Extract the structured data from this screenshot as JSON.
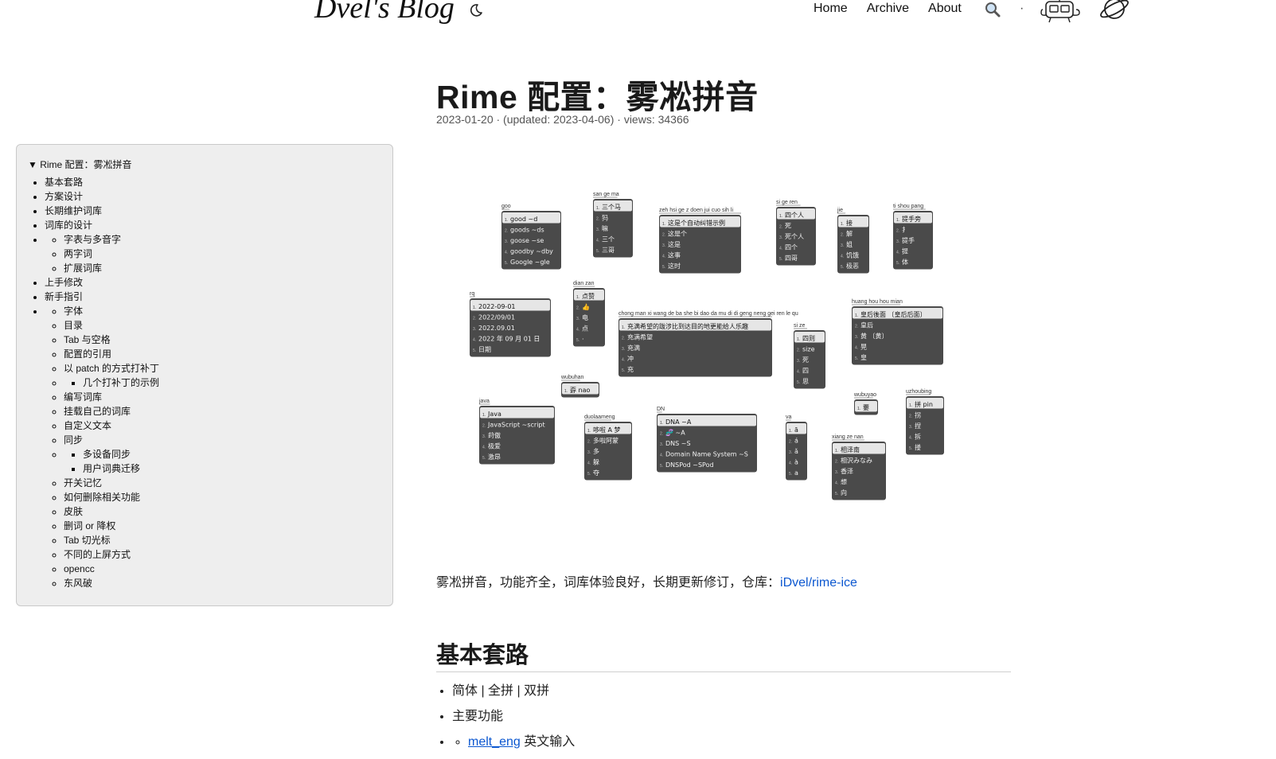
{
  "header": {
    "site_title": "Dvel's Blog",
    "nav": {
      "home": "Home",
      "archive": "Archive",
      "about": "About",
      "separator": "·"
    },
    "icons": [
      "moon-icon",
      "search-icon",
      "robot-icon",
      "planet-icon"
    ]
  },
  "toc": {
    "summary": "▼ Rime 配置：雾凇拼音",
    "items": [
      {
        "label": "基本套路"
      },
      {
        "label": "方案设计"
      },
      {
        "label": "长期维护词库"
      },
      {
        "label": "词库的设计",
        "children": [
          {
            "label": "字表与多音字"
          },
          {
            "label": "两字词"
          },
          {
            "label": "扩展词库"
          }
        ]
      },
      {
        "label": "上手修改"
      },
      {
        "label": "新手指引",
        "children": [
          {
            "label": "字体"
          },
          {
            "label": "目录"
          },
          {
            "label": "Tab 与空格"
          },
          {
            "label": "配置的引用"
          },
          {
            "label": "以 patch 的方式打补丁",
            "children": [
              {
                "label": "几个打补丁的示例"
              }
            ]
          },
          {
            "label": "编写词库"
          },
          {
            "label": "挂载自己的词库"
          },
          {
            "label": "自定义文本"
          },
          {
            "label": "同步",
            "children": [
              {
                "label": "多设备同步"
              },
              {
                "label": "用户词典迁移"
              }
            ]
          },
          {
            "label": "开关记忆"
          },
          {
            "label": "如何删除相关功能"
          },
          {
            "label": "皮肤"
          },
          {
            "label": "删词 or 降权"
          },
          {
            "label": "Tab 切光标"
          },
          {
            "label": "不同的上屏方式"
          },
          {
            "label": "opencc"
          },
          {
            "label": "东风破"
          }
        ]
      }
    ]
  },
  "post": {
    "title": "Rime 配置：雾凇拼音",
    "meta": "2023-01-20 · (updated: 2023-04-06) · views: 34366",
    "intro_text": "雾凇拼音，功能齐全，词库体验良好，长期更新修订，仓库：",
    "intro_link": "iDvel/rime-ice",
    "section_heading": "基本套路",
    "bullets": [
      "简体 | 全拼 | 双拼",
      "主要功能"
    ],
    "sub_bullet_link": "melt_eng",
    "sub_bullet_text": " 英文输入"
  },
  "hero_image": {
    "panels": [
      {
        "code": "goo",
        "items": [
          "good ~d",
          "goods ~ds",
          "goose ~se",
          "goodby ~dby",
          "Google ~gle"
        ]
      },
      {
        "code": "san ge ma",
        "items": [
          "三个马",
          "犸",
          "嘛",
          "三个",
          "三哥"
        ]
      },
      {
        "code": "zeh hsi ge z doen jui cuo sih li",
        "items": [
          "这是个自动纠错示例",
          "这是个",
          "这是",
          "这事",
          "这时"
        ]
      },
      {
        "code": "si ge ren",
        "items": [
          "四个人",
          "死",
          "死个人",
          "四个",
          "四哥"
        ]
      },
      {
        "code": "jie",
        "items": [
          "接",
          "解",
          "姐",
          "饥饿",
          "极恶"
        ]
      },
      {
        "code": "ti shou pang",
        "items": [
          "提手旁",
          "扌",
          "提手",
          "提",
          "体"
        ]
      },
      {
        "code": "rq",
        "items": [
          "2022-09-01",
          "2022/09/01",
          "2022.09.01",
          "2022 年 09 月 01 日",
          "日期"
        ]
      },
      {
        "code": "dian zan",
        "items": [
          "点赞",
          "👍",
          "电",
          "点",
          "·"
        ]
      },
      {
        "code": "chong man xi wang de ba she bi dao da mu di di geng neng gei ren le qu",
        "items": [
          "充满希望的跋涉比到达目的地更能给人乐趣",
          "充满希望",
          "充满",
          "冲",
          "充"
        ]
      },
      {
        "code": "si ze",
        "items": [
          "四则",
          "size",
          "死",
          "四",
          "思"
        ]
      },
      {
        "code": "huang hou hou mian",
        "items": [
          "皇后後面 〔皇后后面〕",
          "皇后",
          "黄 〔黄〕",
          "晃",
          "皇"
        ]
      },
      {
        "code": "wubuhan",
        "items": [
          "孬 nao"
        ]
      },
      {
        "code": "wubuyao",
        "items": [
          "嫑"
        ]
      },
      {
        "code": "uzhoubing",
        "items": [
          "拼 pin",
          "拐",
          "捏",
          "拆",
          "搂"
        ]
      },
      {
        "code": "java",
        "items": [
          "Java",
          "JavaScript ~script",
          "莳傲",
          "极爱",
          "激昂"
        ]
      },
      {
        "code": "duolaameng",
        "items": [
          "哆啦 A 梦",
          "多啦阿蒙",
          "多",
          "躲",
          "夺"
        ]
      },
      {
        "code": "DN",
        "items": [
          "DNA ~A",
          "🧬 ~A",
          "DNS ~S",
          "Domain Name System ~S",
          "DNSPod ~SPod"
        ]
      },
      {
        "code": "va",
        "items": [
          "ā",
          "á",
          "ǎ",
          "à",
          "a"
        ]
      },
      {
        "code": "xiang ze nan",
        "items": [
          "相泽南",
          "相沢みなみ",
          "香泽",
          "想",
          "向"
        ]
      }
    ]
  },
  "colors": {
    "toc_bg": "#eeeeee",
    "link": "#0b57d0",
    "panel_bg": "#4a4a4a",
    "panel_highlight": "#e6e6e6"
  }
}
